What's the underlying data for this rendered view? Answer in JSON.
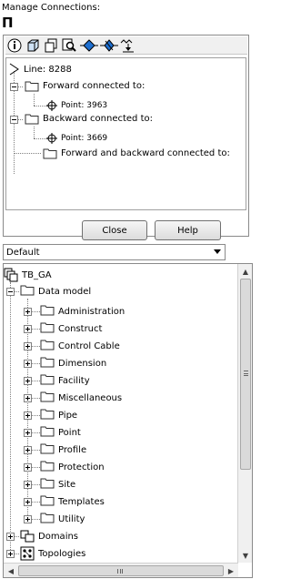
{
  "window": {
    "title": "Manage Connections:",
    "glyph": "Π"
  },
  "toolbar": {
    "icons": [
      "info-icon",
      "cube-icon",
      "copy-icon",
      "find-icon",
      "connect-icon",
      "disconnect-icon",
      "connect-down-icon"
    ]
  },
  "connection_tree": {
    "line": "Line: 8288",
    "forward": "Forward connected to:",
    "forward_point": "Point: 3963",
    "backward": "Backward connected to:",
    "backward_point": "Point: 3669",
    "both": "Forward and backward connected to:"
  },
  "buttons": {
    "close": "Close",
    "help": "Help"
  },
  "dropdown": {
    "selected": "Default"
  },
  "main_tree": {
    "root": "TB_GA",
    "data_model": "Data model",
    "categories": [
      "Administration",
      "Construct",
      "Control Cable",
      "Dimension",
      "Facility",
      "Miscellaneous",
      "Pipe",
      "Point",
      "Profile",
      "Protection",
      "Site",
      "Templates",
      "Utility"
    ],
    "domains": "Domains",
    "topologies": "Topologies"
  },
  "colors": {
    "accent_blue": "#1e6fd0",
    "folder_stroke": "#303030"
  }
}
